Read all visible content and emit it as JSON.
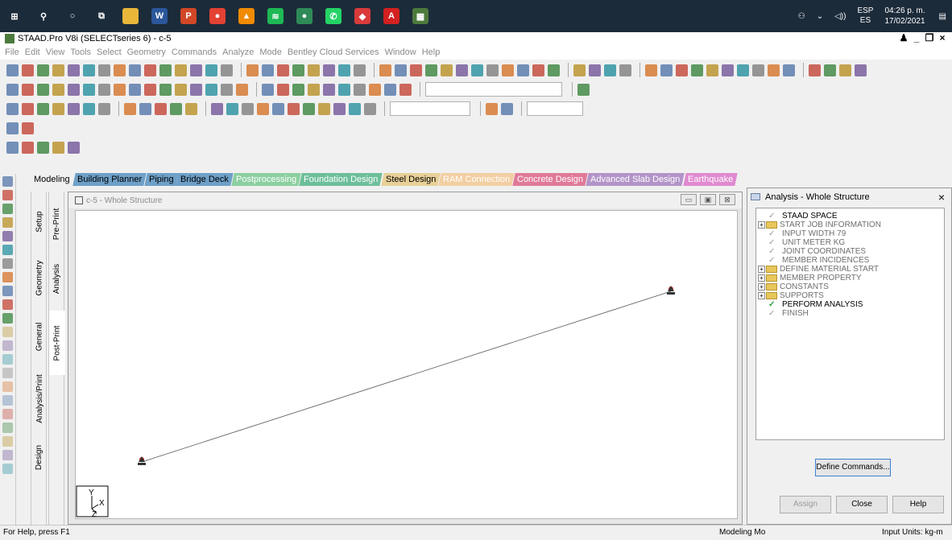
{
  "taskbar": {
    "apps": [
      {
        "icon": "windows-start-icon",
        "color": "#1c2b3a",
        "glyph": "⊞"
      },
      {
        "icon": "search-icon",
        "color": "#1c2b3a",
        "glyph": "⚲"
      },
      {
        "icon": "cortana-icon",
        "color": "#1c2b3a",
        "glyph": "○"
      },
      {
        "icon": "task-view-icon",
        "color": "#1c2b3a",
        "glyph": "⧉"
      },
      {
        "icon": "file-explorer-icon",
        "color": "#e8b73a",
        "glyph": ""
      },
      {
        "icon": "word-icon",
        "color": "#2b579a",
        "glyph": "W"
      },
      {
        "icon": "powerpoint-icon",
        "color": "#d24726",
        "glyph": "P"
      },
      {
        "icon": "chrome-icon",
        "color": "#e34133",
        "glyph": "●"
      },
      {
        "icon": "vlc-icon",
        "color": "#f08a00",
        "glyph": "▲"
      },
      {
        "icon": "spotify-icon",
        "color": "#1db954",
        "glyph": "≋"
      },
      {
        "icon": "app-green-icon",
        "color": "#2e8b57",
        "glyph": "●"
      },
      {
        "icon": "whatsapp-icon",
        "color": "#25d366",
        "glyph": "✆"
      },
      {
        "icon": "app-red-icon",
        "color": "#d93a3a",
        "glyph": "◆"
      },
      {
        "icon": "acrobat-icon",
        "color": "#d32020",
        "glyph": "A"
      },
      {
        "icon": "staad-icon",
        "color": "#4c7a3c",
        "glyph": "▦"
      }
    ],
    "language_top": "ESP",
    "language_bottom": "ES",
    "time": "04:26 p. m.",
    "date": "17/02/2021"
  },
  "window": {
    "title": "STAAD.Pro V8i (SELECTseries 6) - c-5"
  },
  "menu": [
    "File",
    "Edit",
    "View",
    "Tools",
    "Select",
    "Geometry",
    "Commands",
    "Analyze",
    "Mode",
    "Bentley Cloud Services",
    "Window",
    "Help"
  ],
  "page_tabs": [
    {
      "label": "Modeling",
      "bg": "#f0f0f0",
      "fg": "#000000"
    },
    {
      "label": "Building Planner",
      "bg": "#6ea0c8",
      "fg": "#000000"
    },
    {
      "label": "Piping",
      "bg": "#6ea0c8",
      "fg": "#000000"
    },
    {
      "label": "Bridge Deck",
      "bg": "#6ea0c8",
      "fg": "#000000"
    },
    {
      "label": "Postprocessing",
      "bg": "#8ccfa0",
      "fg": "#ffffff"
    },
    {
      "label": "Foundation Design",
      "bg": "#6dbf9a",
      "fg": "#ffffff"
    },
    {
      "label": "Steel Design",
      "bg": "#e8d098",
      "fg": "#000000"
    },
    {
      "label": "RAM Connection",
      "bg": "#f2cfa2",
      "fg": "#ffffff"
    },
    {
      "label": "Concrete Design",
      "bg": "#e07a98",
      "fg": "#ffffff"
    },
    {
      "label": "Advanced Slab Design",
      "bg": "#b394c8",
      "fg": "#ffffff"
    },
    {
      "label": "Earthquake",
      "bg": "#e08ad0",
      "fg": "#ffffff"
    }
  ],
  "left_tabs": {
    "outer": [
      "Setup",
      "Geometry",
      "General",
      "Analysis/Print",
      "Design"
    ],
    "inner": [
      "Pre-Print",
      "Analysis",
      "Post-Print"
    ]
  },
  "view": {
    "title": "c-5 - Whole Structure",
    "axis_y": "Y",
    "axis_x": "X",
    "axis_z": "Z"
  },
  "analysis_panel": {
    "title": "Analysis - Whole Structure",
    "tree": [
      {
        "label": "STAAD SPACE",
        "kind": "check",
        "dark": true
      },
      {
        "label": "START JOB INFORMATION",
        "kind": "folder",
        "dark": false
      },
      {
        "label": "INPUT WIDTH 79",
        "kind": "check",
        "dark": false
      },
      {
        "label": "UNIT METER KG",
        "kind": "check",
        "dark": false
      },
      {
        "label": "JOINT COORDINATES",
        "kind": "check",
        "dark": false
      },
      {
        "label": "MEMBER INCIDENCES",
        "kind": "check",
        "dark": false
      },
      {
        "label": "DEFINE MATERIAL START",
        "kind": "folder",
        "dark": false
      },
      {
        "label": "MEMBER PROPERTY",
        "kind": "folder",
        "dark": false
      },
      {
        "label": "CONSTANTS",
        "kind": "folder",
        "dark": false
      },
      {
        "label": "SUPPORTS",
        "kind": "folder",
        "dark": false
      },
      {
        "label": "PERFORM ANALYSIS",
        "kind": "green",
        "dark": true
      },
      {
        "label": "FINISH",
        "kind": "check",
        "dark": false
      }
    ],
    "define_commands": "Define Commands...",
    "assign": "Assign",
    "close": "Close",
    "help": "Help"
  },
  "status": {
    "help": "For Help, press F1",
    "mode": "Modeling Mo",
    "units": "Input Units:  kg-m"
  }
}
